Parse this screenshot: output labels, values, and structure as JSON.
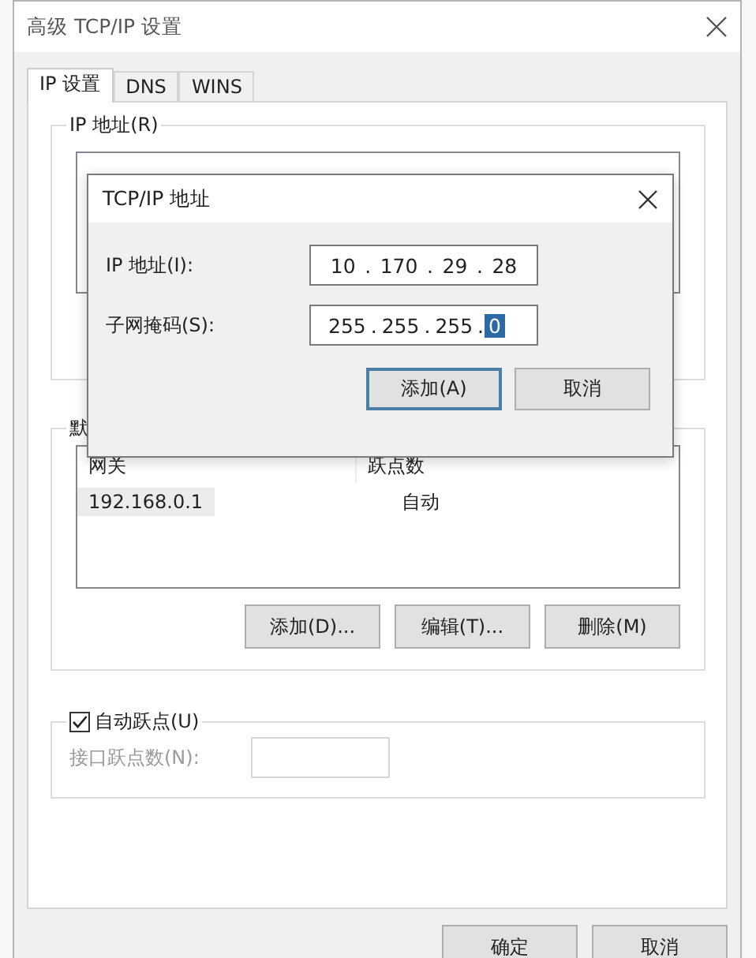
{
  "window": {
    "title": "高级 TCP/IP 设置"
  },
  "tabs": [
    {
      "label": "IP 设置",
      "selected": true
    },
    {
      "label": "DNS",
      "selected": false
    },
    {
      "label": "WINS",
      "selected": false
    }
  ],
  "ip_group": {
    "legend": "IP 地址(R)"
  },
  "gateway_group": {
    "legend": "默",
    "columns": [
      "网关",
      "跃点数"
    ],
    "rows": [
      {
        "cells": [
          "192.168.0.1",
          "自动"
        ],
        "selected": true
      }
    ],
    "buttons": [
      "添加(D)...",
      "编辑(T)...",
      "删除(M)"
    ]
  },
  "metric_group": {
    "checkbox": {
      "label": "自动跃点(U)",
      "checked": true
    },
    "field": {
      "label": "接口跃点数(N):",
      "disabled": true
    }
  },
  "footer_buttons": [
    {
      "label": "确定",
      "default": false
    },
    {
      "label": "取消",
      "default": false
    }
  ],
  "popup": {
    "title": "TCP/IP 地址",
    "separator": ".",
    "fields": [
      {
        "label": "IP 地址(I):",
        "octets": [
          {
            "text": "10",
            "selected": false
          },
          {
            "text": "170",
            "selected": false
          },
          {
            "text": "29",
            "selected": false
          },
          {
            "text": "28",
            "selected": false
          }
        ]
      },
      {
        "label": "子网掩码(S):",
        "octets": [
          {
            "text": "255",
            "selected": false
          },
          {
            "text": "255",
            "selected": false
          },
          {
            "text": "255",
            "selected": false
          },
          {
            "text": "0",
            "selected": true
          }
        ]
      }
    ],
    "buttons": [
      {
        "label": "添加(A)",
        "default": true
      },
      {
        "label": "取消",
        "default": false
      }
    ]
  }
}
